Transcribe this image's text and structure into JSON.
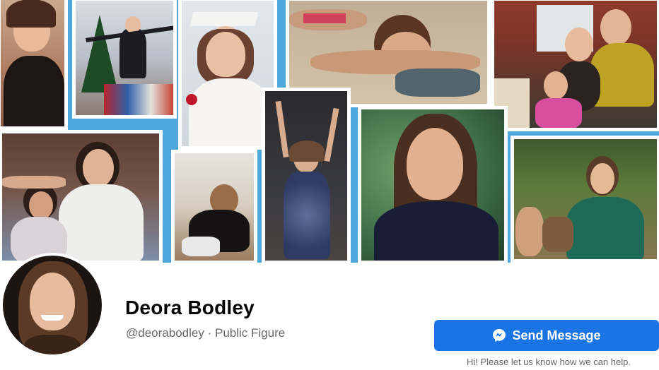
{
  "profile": {
    "name": "Deora Bodley",
    "handle": "@deorabodley",
    "separator": "·",
    "category": "Public Figure"
  },
  "actions": {
    "send_message_label": "Send Message",
    "helper_text": "Hi! Please let us know how we can help."
  },
  "colors": {
    "cover_background": "#4fa6dc",
    "primary_button": "#1b74e4",
    "name_text": "#050505",
    "secondary_text": "#65676b"
  },
  "icons": {
    "send_button": "messenger-icon"
  }
}
